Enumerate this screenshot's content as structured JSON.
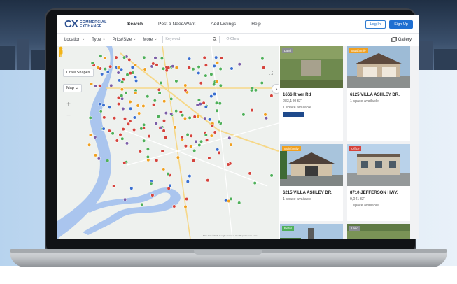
{
  "nav": {
    "logo_mark": "CX",
    "logo_line1": "COMMERCIAL",
    "logo_line2": "EXCHANGE",
    "links": [
      "Search",
      "Post a Need/Want",
      "Add Listings",
      "Help"
    ],
    "login": "Log In",
    "signup": "Sign Up"
  },
  "filters": {
    "items": [
      "Location",
      "Type",
      "Price/Size",
      "More"
    ],
    "keyword_placeholder": "Keyword",
    "clear": "Clear",
    "gallery": "Gallery"
  },
  "map": {
    "draw_shapes": "Draw Shapes",
    "map_type": "Map",
    "zoom_in": "+",
    "zoom_out": "−",
    "attribution": "Map data ©2020 Google   Terms of Use   Report a map error"
  },
  "listings": [
    {
      "tag": "Land",
      "tag_color": "gray",
      "address": "1666 River Rd",
      "size": "283,140 SF",
      "availability": "1 space available",
      "has_broker_logo": true
    },
    {
      "tag": "Multifamily",
      "tag_color": "orange",
      "address": "6125 VILLA ASHLEY DR.",
      "size": "",
      "availability": "1 space available"
    },
    {
      "tag": "Multifamily",
      "tag_color": "orange",
      "address": "6215 VILLA ASHLEY DR.",
      "size": "",
      "availability": "1 space available"
    },
    {
      "tag": "Office",
      "tag_color": "red",
      "address": "8710 JEFFERSON HWY.",
      "size": "9,041 SF",
      "availability": "1 space available"
    },
    {
      "tag": "Retail",
      "tag_color": "green",
      "address": "",
      "size": "",
      "availability": ""
    },
    {
      "tag": "Land",
      "tag_color": "gray",
      "address": "",
      "size": "",
      "availability": ""
    }
  ],
  "icons": {
    "search": "search-icon",
    "chevron": "chevron-down-icon",
    "gallery": "gallery-icon",
    "expand": "fullscreen-icon",
    "pegman": "street-view-icon",
    "arrow": "chevron-right-icon"
  },
  "colors": {
    "brand": "#2b4f8f",
    "accent": "#1f6fd1",
    "marker_red": "#d5433c",
    "marker_green": "#4fb05a",
    "marker_blue": "#3a6fd0",
    "marker_purple": "#7b5ea7",
    "marker_orange": "#f0a020"
  }
}
